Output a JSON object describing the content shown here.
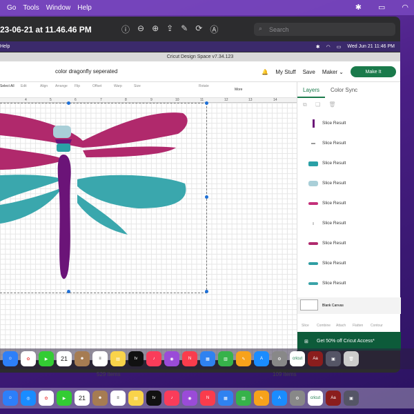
{
  "menubar": {
    "items": [
      "Go",
      "Tools",
      "Window",
      "Help"
    ]
  },
  "preview": {
    "title": "23-06-21 at 11.46.46 PM",
    "search_placeholder": "Search"
  },
  "inner_menubar": {
    "left": "Help",
    "date": "Wed Jun 21  11:46 PM"
  },
  "app": {
    "window_title": "Cricut Design Space  v7.34.123",
    "project_name": "color dragonfly seperated",
    "my_stuff": "My Stuff",
    "save": "Save",
    "machine": "Maker",
    "make_it": "Make It"
  },
  "toolbar": {
    "select_all": "Select All",
    "edit": "Edit",
    "align": "Align",
    "arrange": "Arrange",
    "flip": "Flip",
    "offset": "Offset",
    "warp": "Warp",
    "size": "Size",
    "rotate": "Rotate",
    "more": "More"
  },
  "ruler": {
    "ticks": [
      "4",
      "5",
      "6",
      "7",
      "8",
      "9",
      "10",
      "11",
      "12",
      "13",
      "14"
    ]
  },
  "layers_panel": {
    "tabs": [
      "Layers",
      "Color Sync"
    ],
    "items": [
      {
        "label": "Slice Result",
        "color": "#6b1478"
      },
      {
        "label": "Slice Result",
        "color": "#9a9a9a"
      },
      {
        "label": "Slice Result",
        "color": "#2aa0a6"
      },
      {
        "label": "Slice Result",
        "color": "#a9cfd8"
      },
      {
        "label": "Slice Result",
        "color": "#c4307a"
      },
      {
        "label": "Slice Result",
        "color": "#cccccc"
      },
      {
        "label": "Slice Result",
        "color": "#b02a6e"
      },
      {
        "label": "Slice Result",
        "color": "#2f9ea3"
      },
      {
        "label": "Slice Result",
        "color": "#3aa3a8"
      }
    ],
    "blank_canvas": "Blank Canvas",
    "bottom_tools": [
      "Slice",
      "Combine",
      "Attach",
      "Flatten",
      "Contour"
    ],
    "promo": "Get 50% off Cricut Access*"
  },
  "colors": {
    "purple": "#6b1478",
    "magenta": "#b0296c",
    "teal": "#3aa7ad",
    "light_blue": "#a9cfd8",
    "make_it_green": "#1a7a4b"
  },
  "dock_date": "21",
  "bg_reviews": {
    "left": "529 items",
    "right": "109 items"
  }
}
